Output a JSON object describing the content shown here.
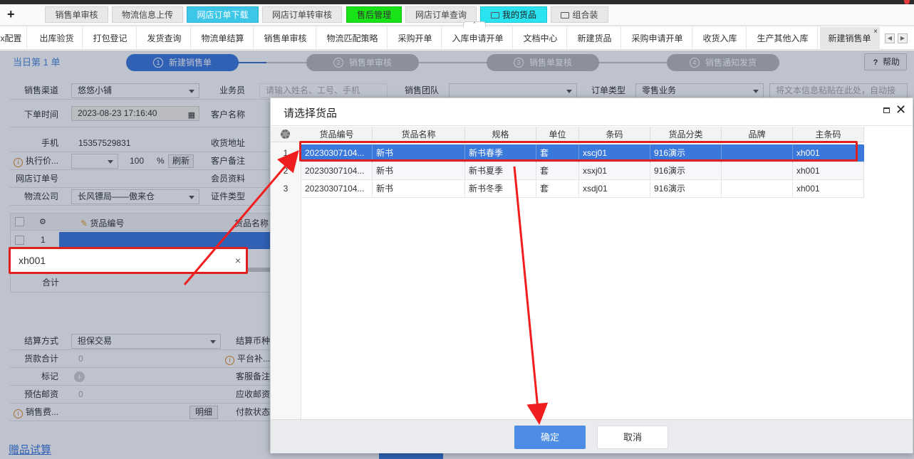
{
  "quickbar": {
    "plus": "+",
    "buttons": [
      {
        "label": "销售单审核",
        "style": "gray"
      },
      {
        "label": "物流信息上传",
        "style": "gray"
      },
      {
        "label": "网店订单下载",
        "style": "cyan"
      },
      {
        "label": "网店订单转审核",
        "style": "gray"
      },
      {
        "label": "售后管理",
        "style": "green"
      },
      {
        "label": "网店订单查询",
        "style": "gray"
      },
      {
        "label": "我的货品",
        "style": "lightcyan",
        "icon": "folder-icon"
      },
      {
        "label": "组合装",
        "style": "gray",
        "icon": "folder-icon"
      }
    ]
  },
  "navtabs": {
    "items": [
      {
        "label": "x配置"
      },
      {
        "label": "出库验货"
      },
      {
        "label": "打包登记"
      },
      {
        "label": "发货查询"
      },
      {
        "label": "物流单结算"
      },
      {
        "label": "销售单审核"
      },
      {
        "label": "物流匹配策略"
      },
      {
        "label": "采购开单"
      },
      {
        "label": "入库申请开单"
      },
      {
        "label": "文档中心"
      },
      {
        "label": "新建货品"
      },
      {
        "label": "采购申请开单"
      },
      {
        "label": "收货入库"
      },
      {
        "label": "生产其他入库"
      },
      {
        "label": "新建销售单",
        "active": true
      }
    ],
    "close_glyph": "×",
    "prev_glyph": "◀",
    "next_glyph": "▶"
  },
  "page": {
    "day_count": "当日第  1  单",
    "steps": [
      {
        "num": "1",
        "label": "新建销售单",
        "active": true
      },
      {
        "num": "2",
        "label": "销售单审核",
        "active": false
      },
      {
        "num": "3",
        "label": "销售单复核",
        "active": false
      },
      {
        "num": "4",
        "label": "销售通知发货",
        "active": false
      }
    ],
    "help_label": "帮助",
    "help_glyph": "?",
    "form": {
      "channel_label": "销售渠道",
      "channel_value": "悠悠小铺",
      "salesman_label": "业务员",
      "salesman_placeholder": "请输入姓名、工号、手机",
      "team_label": "销售团队",
      "order_type_label": "订单类型",
      "order_type_value": "零售业务",
      "paste_placeholder": "将文本信息粘贴在此处，自动接",
      "order_time_label": "下单时间",
      "order_time_value": "2023-08-23 17:16:40",
      "customer_label": "客户名称",
      "phone_label": "手机",
      "phone_value": "15357529831",
      "address_label": "收货地址",
      "exec_price_label": "执行价...",
      "percent_value": "100",
      "percent_sign": "%",
      "refresh_label": "刷新",
      "customer_note_label": "客户备注",
      "online_order_label": "网店订单号",
      "member_label": "会员资料",
      "logistics_label": "物流公司",
      "logistics_value": "长风镖局——傲来仓",
      "cert_label": "证件类型"
    },
    "grid": {
      "col_code": "货品编号",
      "col_name": "货品名称",
      "row_num": "1",
      "total_label": "合计"
    },
    "search": {
      "value": "xh001",
      "clear_glyph": "×"
    },
    "lower": {
      "settle_label": "结算方式",
      "settle_value": "担保交易",
      "currency_label": "结算币种",
      "goods_total_label": "货款合计",
      "goods_total_value": "0",
      "platform_label": "平台补...",
      "mark_label": "标记",
      "service_note_label": "客服备注",
      "est_postage_label": "预估邮资",
      "est_postage_value": "0",
      "receivable_label": "应收邮资",
      "sales_fee_label": "销售费...",
      "detail_label": "明细",
      "pay_status_label": "付款状态"
    },
    "gift_link": "赠品试算"
  },
  "modal": {
    "title": "请选择货品",
    "columns": [
      "货品编号",
      "货品名称",
      "规格",
      "单位",
      "条码",
      "货品分类",
      "品牌",
      "主条码"
    ],
    "rows": [
      {
        "num": "1",
        "code": "20230307104...",
        "name": "新书",
        "spec": "新书春季",
        "unit": "套",
        "barcode": "xscj01",
        "category": "916演示",
        "brand": "",
        "main_barcode": "xh001"
      },
      {
        "num": "2",
        "code": "20230307104...",
        "name": "新书",
        "spec": "新书夏季",
        "unit": "套",
        "barcode": "xsxj01",
        "category": "916演示",
        "brand": "",
        "main_barcode": "xh001"
      },
      {
        "num": "3",
        "code": "20230307104...",
        "name": "新书",
        "spec": "新书冬季",
        "unit": "套",
        "barcode": "xsdj01",
        "category": "916演示",
        "brand": "",
        "main_barcode": "xh001"
      }
    ],
    "selected_row": 1,
    "ok_label": "确定",
    "cancel_label": "取消",
    "close_glyph": "✕"
  },
  "colors": {
    "accent": "#3b78db",
    "annotation": "#e02020",
    "tab_cyan": "#3cc6e8",
    "tab_green": "#17e317"
  }
}
